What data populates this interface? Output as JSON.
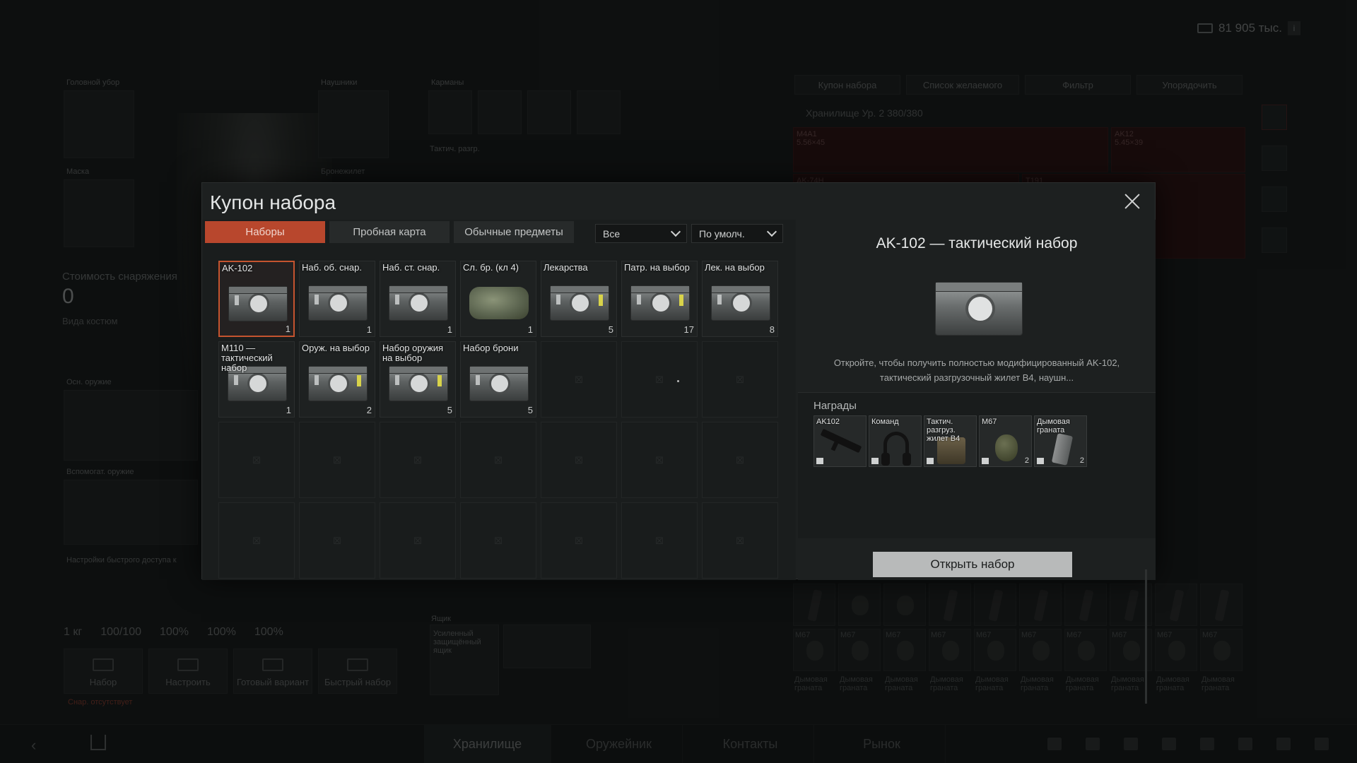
{
  "header": {
    "money": "81 905 тыс."
  },
  "loadout": {
    "headwear_label": "Головной убор",
    "headphones_label": "Наушники",
    "pockets_label": "Карманы",
    "mask_label": "Маска",
    "armor_label": "Бронежилет",
    "tactical_label": "Тактич. разгр.",
    "equip_cost_label": "Стоимость снаряжения",
    "equip_cost_value": "0",
    "costume_label": "Вида костюм",
    "primary_label": "Осн. оружие",
    "secondary_label": "Вспомогат. оружие",
    "quickslots_label": "Настройки быстрого доступа к",
    "box_label": "Ящик",
    "box_item": "Усиленный защищённый ящик",
    "stats": [
      "1 кг",
      "100/100",
      "100%",
      "100%",
      "100%"
    ],
    "actions": [
      "Набор",
      "Настроить",
      "Готовый вариант",
      "Быстрый набор"
    ],
    "missing": "Снар. отсутствует"
  },
  "storage": {
    "buttons": [
      "Купон набора",
      "Список желаемого",
      "Фильтр",
      "Упорядочить"
    ],
    "title": "Хранилище Ур. 2 380/380",
    "weapons": [
      {
        "name": "M4A1",
        "ammo": "5.56×45"
      },
      {
        "name": "AK12",
        "ammo": "5.45×39"
      },
      {
        "name": "AK-74H",
        "ammo": ""
      },
      {
        "name": "T191",
        "ammo": ""
      }
    ],
    "grenade_label": "Дымовая граната",
    "m67": "M67"
  },
  "nav": {
    "tabs": [
      "Хранилище",
      "Оружейник",
      "Контакты",
      "Рынок"
    ],
    "active": 0
  },
  "modal": {
    "title": "Купон набора",
    "tabs": [
      "Наборы",
      "Пробная карта",
      "Обычные предметы"
    ],
    "active_tab": 0,
    "filter_value": "Все",
    "sort_value": "По умолч.",
    "items": [
      {
        "name": "AK-102",
        "count": "1",
        "kind": "crate",
        "selected": true
      },
      {
        "name": "Наб. об. снар.",
        "count": "1",
        "kind": "crate"
      },
      {
        "name": "Наб. ст. снар.",
        "count": "1",
        "kind": "crate"
      },
      {
        "name": "Сл. бр. (кл 4)",
        "count": "1",
        "kind": "bag"
      },
      {
        "name": "Лекарства",
        "count": "5",
        "kind": "crate",
        "tag": true
      },
      {
        "name": "Патр. на выбор",
        "count": "17",
        "kind": "crate",
        "tag": true
      },
      {
        "name": "Лек. на выбор",
        "count": "8",
        "kind": "crate"
      },
      {
        "name": "M110 — тактический набор",
        "count": "1",
        "kind": "crate"
      },
      {
        "name": "Оруж. на выбор",
        "count": "2",
        "kind": "crate",
        "tag": true
      },
      {
        "name": "Набор оружия на выбор",
        "count": "5",
        "kind": "crate",
        "tag": true
      },
      {
        "name": "Набор брони",
        "count": "5",
        "kind": "crate"
      }
    ],
    "detail": {
      "title": "AK-102 — тактический набор",
      "description": "Откройте, чтобы получить полностью модифицированный AK-102, тактический разгрузочный жилет B4, наушн...",
      "rewards_label": "Награды",
      "rewards": [
        {
          "name": "AK102",
          "count": "",
          "icon": "rifle"
        },
        {
          "name": "Команд",
          "count": "",
          "icon": "headset"
        },
        {
          "name": "Тактич. разгруз. жилет B4",
          "count": "",
          "icon": "vest"
        },
        {
          "name": "M67",
          "count": "2",
          "icon": "grenade"
        },
        {
          "name": "Дымовая граната",
          "count": "2",
          "icon": "smoke"
        }
      ],
      "open_button": "Открыть набор"
    }
  }
}
